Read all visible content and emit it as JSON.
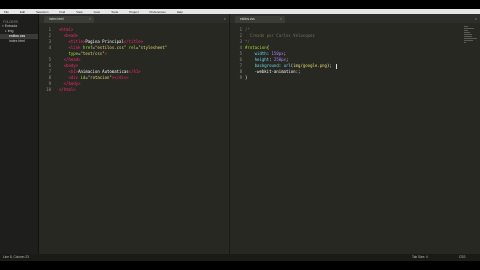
{
  "menubar": {
    "items": [
      "File",
      "Edit",
      "Selection",
      "Find",
      "View",
      "Goto",
      "Tools",
      "Project",
      "Preferences",
      "Help"
    ]
  },
  "sidebar": {
    "title": "FOLDERS",
    "items": [
      {
        "label": "Entrada",
        "indent": 0
      },
      {
        "label": "img",
        "indent": 1
      },
      {
        "label": "estilos.css",
        "indent": 1
      },
      {
        "label": "index.html",
        "indent": 1
      }
    ]
  },
  "left_tab": {
    "label": "index.html",
    "close": "×"
  },
  "left_pane_close": "×",
  "right_tab": {
    "label": "estilos.css",
    "close": "×"
  },
  "right_pane_close": "×",
  "left_code": [
    {
      "n": "1",
      "parts": [
        [
          "",
          "  "
        ],
        [
          "tag",
          "<html>"
        ]
      ]
    },
    {
      "n": "2",
      "parts": [
        [
          "",
          "    "
        ],
        [
          "tag",
          "<head>"
        ]
      ]
    },
    {
      "n": "3",
      "parts": [
        [
          "",
          "      "
        ],
        [
          "tag",
          "<title>"
        ],
        [
          "",
          "Pagina Principal"
        ],
        [
          "tag",
          "</title>"
        ]
      ]
    },
    {
      "n": "4",
      "parts": [
        [
          "",
          "      "
        ],
        [
          "tag",
          "<link "
        ],
        [
          "attr",
          "href"
        ],
        [
          "",
          "="
        ],
        [
          "str",
          "\"estilos.css\""
        ],
        [
          "attr",
          " rel"
        ],
        [
          "",
          "="
        ],
        [
          "str",
          "\"stylesheet\""
        ]
      ]
    },
    {
      "n": "",
      "parts": [
        [
          "",
          "      "
        ],
        [
          "attr",
          "type"
        ],
        [
          "",
          "="
        ],
        [
          "str",
          "\"text/css\""
        ],
        [
          "tag",
          ">"
        ]
      ]
    },
    {
      "n": "5",
      "parts": [
        [
          "",
          "    "
        ],
        [
          "tag",
          "</head>"
        ]
      ]
    },
    {
      "n": "6",
      "parts": [
        [
          "",
          "    "
        ],
        [
          "tag",
          "<body>"
        ]
      ]
    },
    {
      "n": "7",
      "parts": [
        [
          "",
          "      "
        ],
        [
          "tag",
          "<h1>"
        ],
        [
          "",
          "Animacion Automaticas"
        ],
        [
          "tag",
          "</h1>"
        ]
      ]
    },
    {
      "n": "8",
      "parts": [
        [
          "",
          "      "
        ],
        [
          "tag",
          "<div "
        ],
        [
          "attr",
          "id"
        ],
        [
          "",
          "="
        ],
        [
          "str",
          "\"rotacion\""
        ],
        [
          "tag",
          "></div>"
        ]
      ]
    },
    {
      "n": "9",
      "parts": [
        [
          "",
          "    "
        ],
        [
          "tag",
          "</body>"
        ]
      ]
    },
    {
      "n": "10",
      "parts": [
        [
          "",
          "  "
        ],
        [
          "tag",
          "</html>"
        ]
      ]
    }
  ],
  "right_code": [
    {
      "n": "1",
      "parts": [
        [
          "cm",
          "/*"
        ]
      ]
    },
    {
      "n": "2",
      "parts": [
        [
          "cm",
          "  Creado por Carlos Velasquez"
        ]
      ]
    },
    {
      "n": "3",
      "parts": [
        [
          "cm",
          "*/"
        ]
      ]
    },
    {
      "n": "4",
      "parts": [
        [
          "sel-id",
          "#rotacion"
        ],
        [
          "",
          "{"
        ]
      ]
    },
    {
      "n": "5",
      "parts": [
        [
          "",
          "    "
        ],
        [
          "kw",
          "width"
        ],
        [
          "",
          ": "
        ],
        [
          "num",
          "150px"
        ],
        [
          "",
          ";"
        ]
      ]
    },
    {
      "n": "6",
      "parts": [
        [
          "",
          "    "
        ],
        [
          "kw",
          "height"
        ],
        [
          "",
          ": "
        ],
        [
          "num",
          "250px"
        ],
        [
          "",
          ";"
        ]
      ]
    },
    {
      "n": "7",
      "parts": [
        [
          "",
          "    "
        ],
        [
          "kw",
          "background"
        ],
        [
          "",
          ": "
        ],
        [
          "kw",
          "url"
        ],
        [
          "",
          "("
        ],
        [
          "str",
          "img/google.png"
        ],
        [
          "",
          ");"
        ]
      ]
    },
    {
      "n": "8",
      "parts": [
        [
          "",
          "    -webkit-animation:;"
        ]
      ]
    },
    {
      "n": "9",
      "parts": [
        [
          "",
          "}"
        ]
      ]
    }
  ],
  "status": {
    "left": "Line 8, Column 23",
    "tab_size": "Tab Size: 4",
    "syntax": "CSS"
  }
}
